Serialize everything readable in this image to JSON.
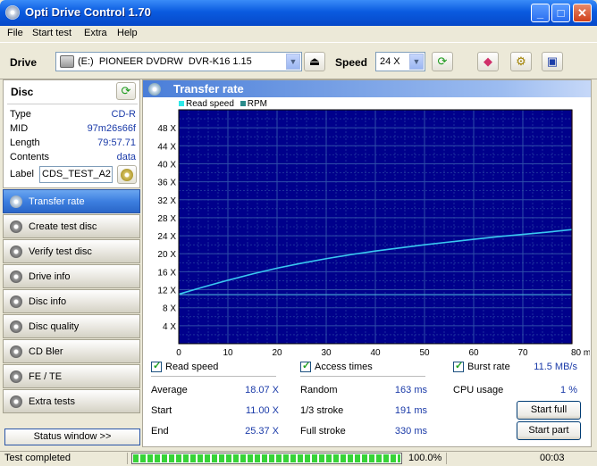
{
  "window": {
    "title": "Opti Drive Control 1.70"
  },
  "menu": [
    "File",
    "Start test",
    "Extra",
    "Help"
  ],
  "toolbar": {
    "drive_label": "Drive",
    "drive_value": "(E:)  PIONEER DVDRW  DVR-K16 1.15",
    "speed_label": "Speed",
    "speed_value": "24 X"
  },
  "disc": {
    "title": "Disc",
    "rows": [
      {
        "key": "Type",
        "value": "CD-R"
      },
      {
        "key": "MID",
        "value": "97m26s66f"
      },
      {
        "key": "Length",
        "value": "79:57.71"
      },
      {
        "key": "Contents",
        "value": "data"
      }
    ],
    "label_key": "Label",
    "label_value": "CDS_TEST_A2"
  },
  "nav": [
    {
      "label": "Transfer rate",
      "active": true
    },
    {
      "label": "Create test disc"
    },
    {
      "label": "Verify test disc"
    },
    {
      "label": "Drive info"
    },
    {
      "label": "Disc info"
    },
    {
      "label": "Disc quality"
    },
    {
      "label": "CD Bler"
    },
    {
      "label": "FE / TE"
    },
    {
      "label": "Extra tests"
    }
  ],
  "status_window_label": "Status window >>",
  "panel": {
    "title": "Transfer rate"
  },
  "chart_data": {
    "type": "line",
    "legend": [
      "Read speed",
      "RPM"
    ],
    "legend_colors": [
      "#2de8e8",
      "#2a8a8a"
    ],
    "x_ticks": [
      "0",
      "10",
      "20",
      "30",
      "40",
      "50",
      "60",
      "70",
      "80 min"
    ],
    "y_ticks": [
      "4 X",
      "8 X",
      "12 X",
      "16 X",
      "20 X",
      "24 X",
      "28 X",
      "32 X",
      "36 X",
      "40 X",
      "44 X",
      "48 X"
    ],
    "xlim": [
      0,
      80
    ],
    "ylim": [
      0,
      52
    ],
    "series": [
      {
        "name": "Read speed",
        "color": "#39c8f0",
        "x": [
          0,
          5,
          10,
          15,
          20,
          25,
          30,
          35,
          40,
          45,
          50,
          55,
          60,
          65,
          70,
          75,
          80
        ],
        "y": [
          11.0,
          12.6,
          14.1,
          15.5,
          16.8,
          17.9,
          18.9,
          19.8,
          20.6,
          21.3,
          22.0,
          22.6,
          23.2,
          23.8,
          24.3,
          24.8,
          25.37
        ]
      },
      {
        "name": "RPM",
        "color": "#4ab0d8",
        "x": [
          0,
          80
        ],
        "y": [
          10.9,
          10.9
        ]
      }
    ],
    "background": "#00008b",
    "grid_color": "#2e4ea8"
  },
  "checks": {
    "read_speed": "Read speed",
    "access_times": "Access times",
    "burst_rate": "Burst rate"
  },
  "burst_rate_value": "11.5 MB/s",
  "stats": {
    "average_label": "Average",
    "average_value": "18.07 X",
    "start_label": "Start",
    "start_value": "11.00 X",
    "end_label": "End",
    "end_value": "25.37 X",
    "random_label": "Random",
    "random_value": "163 ms",
    "third_label": "1/3 stroke",
    "third_value": "191 ms",
    "full_label": "Full stroke",
    "full_value": "330 ms",
    "cpu_label": "CPU usage",
    "cpu_value": "1 %"
  },
  "buttons": {
    "start_full": "Start full",
    "start_part": "Start part"
  },
  "status": {
    "text": "Test completed",
    "progress_pct": "100.0%",
    "progress": 1.0,
    "elapsed": "00:03"
  }
}
